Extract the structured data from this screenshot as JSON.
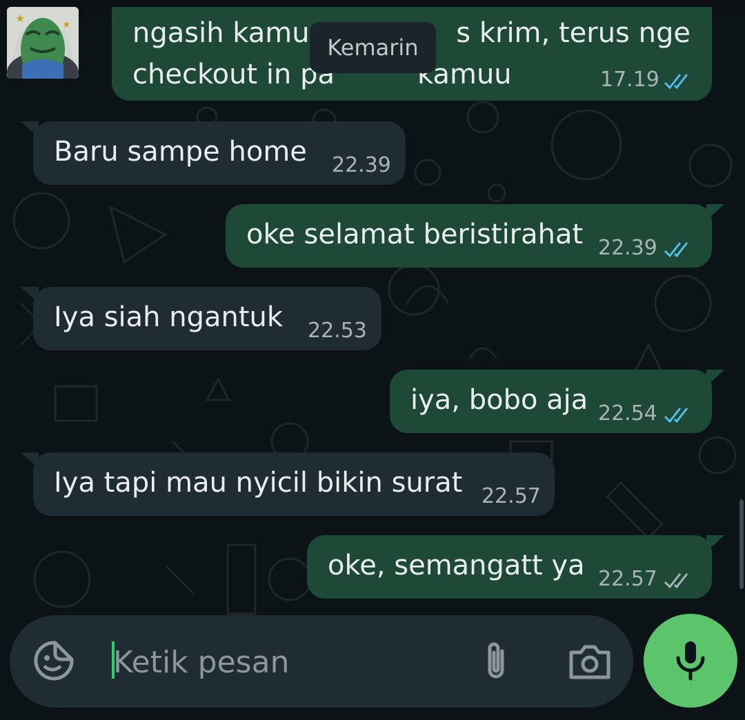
{
  "conversation": {
    "date_chip": "Kemarin",
    "first_message": {
      "line1": "ngasih kamu ",
      "line1_tail": "s krim, terus nge",
      "line2": "checkout in pa",
      "line2_tail": "kamuu",
      "time": "17.19",
      "status": "read"
    },
    "messages": [
      {
        "side": "in",
        "text": "Baru sampe home",
        "time": "22.39"
      },
      {
        "side": "out",
        "text": "oke selamat beristirahat",
        "time": "22.39",
        "status": "read"
      },
      {
        "side": "in",
        "text": "Iya siah ngantuk",
        "time": "22.53"
      },
      {
        "side": "out",
        "text": "iya, bobo aja",
        "time": "22.54",
        "status": "read"
      },
      {
        "side": "in",
        "text": "Iya tapi mau nyicil bikin surat",
        "time": "22.57"
      },
      {
        "side": "out",
        "text": "oke, semangatt ya",
        "time": "22.57",
        "status": "delivered"
      }
    ]
  },
  "composer": {
    "placeholder": "Ketik pesan",
    "value": ""
  },
  "icons": {
    "emoji": "sticker-icon",
    "attach": "paperclip-icon",
    "camera": "camera-icon",
    "mic": "microphone-icon",
    "read": "double-check-blue-icon",
    "delivered": "double-check-grey-icon"
  },
  "colors": {
    "background": "#0c1317",
    "incoming_bubble": "#202c33",
    "outgoing_bubble": "#1e4936",
    "read_tick": "#53bdeb",
    "delivered_tick": "#a9b3ba",
    "mic_button": "#5cc46a",
    "cursor": "#25d366"
  }
}
